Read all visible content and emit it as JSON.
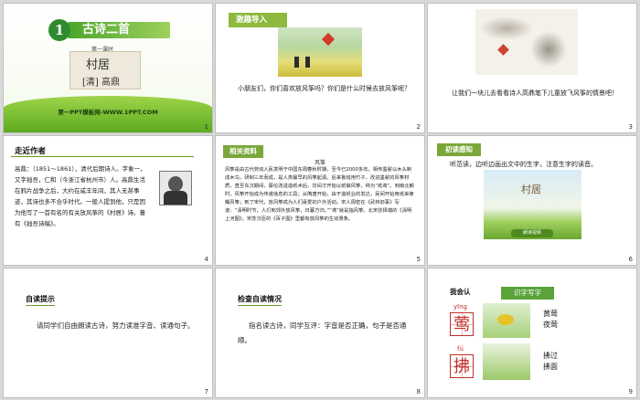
{
  "slides": [
    {
      "num": "1",
      "badge": "1",
      "title": "古诗二首",
      "lesson": "第一课时",
      "poem_title": "村居",
      "author": "[清] 高鼎",
      "footer": "第一PPT模板网-WWW.1PPT.COM"
    },
    {
      "num": "2",
      "header": "激趣导入",
      "text": "小朋友们，你们喜欢放风筝吗？你们是什么时候去放风筝呢？"
    },
    {
      "num": "3",
      "text": "让我们一块儿去看看诗人高鼎笔下儿童放飞风筝的情景吧！"
    },
    {
      "num": "4",
      "header": "走近作者",
      "text": "高鼎：（1851～1861），清代后期诗人。字象一，又字拙吾，仁和（今浙江省杭州市）人。高鼎生活在鸦片战争之后，大约在咸丰年间，其人无甚事迹，其诗也多不合乎时代。一般人提到他，只是因为他写了一首有名的有关放风筝的《村居》诗。著有《拙吾诗稿》。"
    },
    {
      "num": "5",
      "header": "相关资料",
      "kite_title": "风筝",
      "text": "风筝是由古代劳动人民发明于中国东周春秋时期，至今已2000多年。相传墨翟以木头制成木鸟，研制三年而成，是人类最早的风筝起源。后来鲁班用竹子，改进墨翟的风筝材质，直至东汉期间，蔡伦改进造纸术后，坊间才开始以纸做风筝，称为“纸鸢”。到南北朝时，风筝开始成为传递信息的工具；从隋唐开始，由于造纸业的发达，民间开始用纸来裱糊风筝；到了宋代，放风筝成为人们喜爱的户外活动。宋人周密在《武林旧事》写道：“清明时节，人们到郊外放风筝，日暮方归。”“鸢”就是指风筝。北宋张择端的《清明上河图》，宋苏汉臣的《百子图》里都有放风筝的生动景象。"
    },
    {
      "num": "6",
      "header": "初读感知",
      "instruction": "听范读，边听边画出文中的生字，注意生字的读音。",
      "video_title": "村居",
      "button": "朗读视频"
    },
    {
      "num": "7",
      "header": "自读提示",
      "text": "请同学们自由朗读古诗，努力读准字音、读通句子。"
    },
    {
      "num": "8",
      "header": "检查自读情况",
      "text": "指名读古诗，同学互评：字音是否正确，句子是否通顺。"
    },
    {
      "num": "9",
      "header": "我会认",
      "tab": "识字写字",
      "chars": [
        {
          "pinyin": "yīng",
          "char": "莺",
          "words": [
            "黄莺",
            "夜莺"
          ]
        },
        {
          "pinyin": "fú",
          "char": "拂",
          "words": [
            "拂过",
            "拂面"
          ]
        }
      ]
    }
  ]
}
